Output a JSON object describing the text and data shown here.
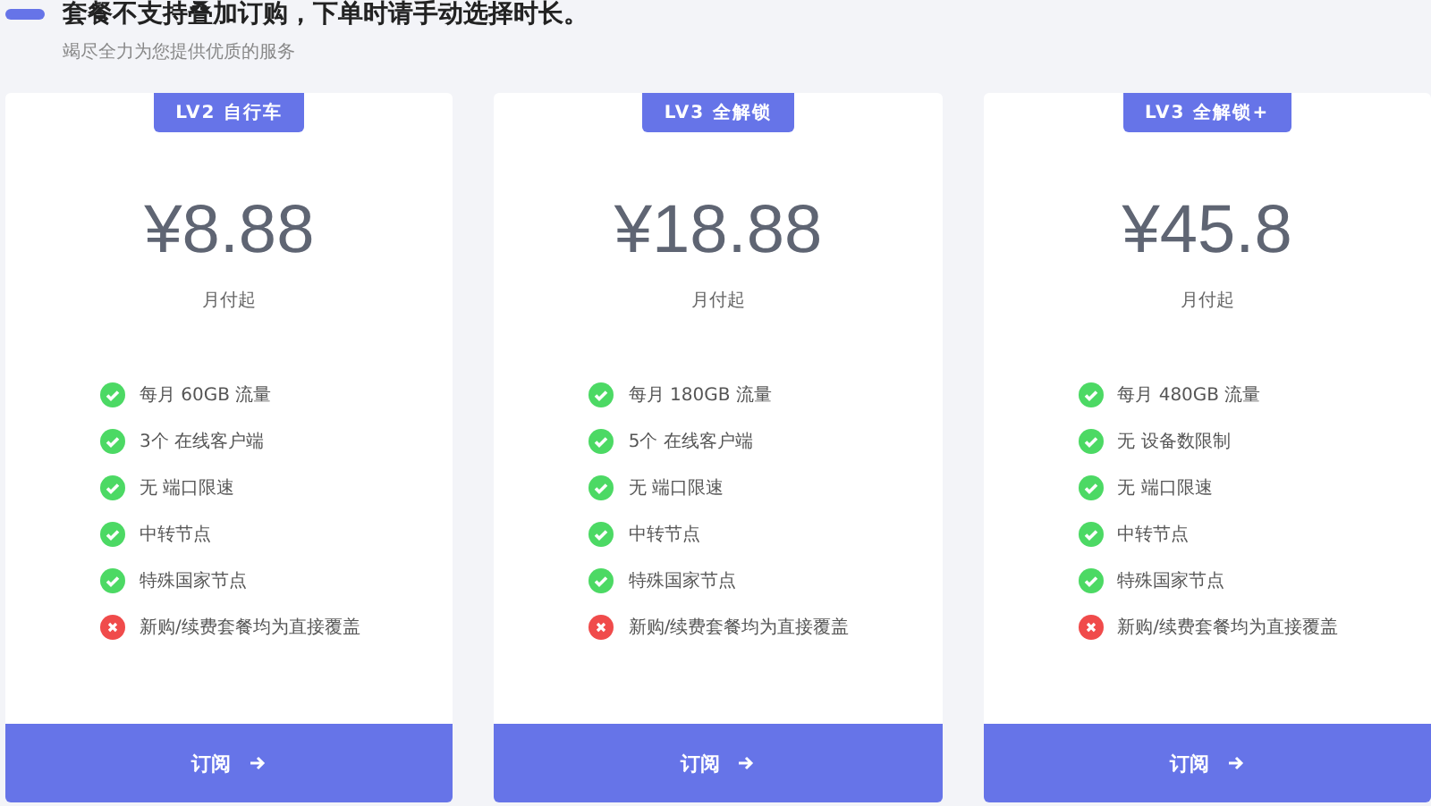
{
  "header": {
    "title": "套餐不支持叠加订购，下单时请手动选择时长。",
    "subtitle": "竭尽全力为您提供优质的服务"
  },
  "plans": [
    {
      "badge": "LV2 自行车",
      "price": "¥8.88",
      "period": "月付起",
      "features": [
        {
          "text": "每月 60GB 流量",
          "included": true
        },
        {
          "text": "3个 在线客户端",
          "included": true
        },
        {
          "text": "无 端口限速",
          "included": true
        },
        {
          "text": "中转节点",
          "included": true
        },
        {
          "text": "特殊国家节点",
          "included": true
        },
        {
          "text": "新购/续费套餐均为直接覆盖",
          "included": false
        }
      ],
      "button": "订阅"
    },
    {
      "badge": "LV3 全解锁",
      "price": "¥18.88",
      "period": "月付起",
      "features": [
        {
          "text": "每月 180GB 流量",
          "included": true
        },
        {
          "text": "5个 在线客户端",
          "included": true
        },
        {
          "text": "无 端口限速",
          "included": true
        },
        {
          "text": "中转节点",
          "included": true
        },
        {
          "text": "特殊国家节点",
          "included": true
        },
        {
          "text": "新购/续费套餐均为直接覆盖",
          "included": false
        }
      ],
      "button": "订阅"
    },
    {
      "badge": "LV3 全解锁+",
      "price": "¥45.8",
      "period": "月付起",
      "features": [
        {
          "text": "每月 480GB 流量",
          "included": true
        },
        {
          "text": "无 设备数限制",
          "included": true
        },
        {
          "text": "无 端口限速",
          "included": true
        },
        {
          "text": "中转节点",
          "included": true
        },
        {
          "text": "特殊国家节点",
          "included": true
        },
        {
          "text": "新购/续费套餐均为直接覆盖",
          "included": false
        }
      ],
      "button": "订阅"
    }
  ]
}
